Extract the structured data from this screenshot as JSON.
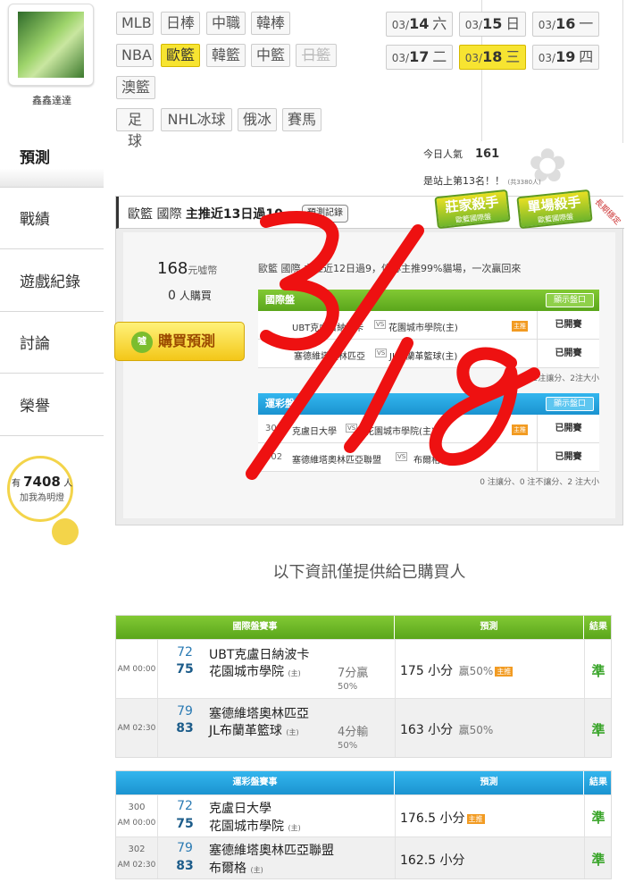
{
  "user": {
    "name": "鑫鑫達達"
  },
  "sidebar": {
    "items": [
      {
        "label": "預測",
        "active": true
      },
      {
        "label": "戰績"
      },
      {
        "label": "遊戲紀錄"
      },
      {
        "label": "討論"
      },
      {
        "label": "榮譽"
      }
    ]
  },
  "followers": {
    "prefix": "有",
    "count": "7408",
    "suffix": "人",
    "line2": "加我為明燈"
  },
  "sports": {
    "row1": [
      "MLB",
      "日棒",
      "中職",
      "韓棒"
    ],
    "row2": [
      "NBA",
      "歐籃",
      "韓籃",
      "中籃",
      "日籃"
    ],
    "row3": [
      "澳籃"
    ],
    "row4": [
      "足球",
      "NHL冰球",
      "俄冰",
      "賽馬"
    ],
    "selected": "歐籃",
    "disabled": "日籃"
  },
  "dates": [
    {
      "md": "03/",
      "d": "14",
      "wd": "六"
    },
    {
      "md": "03/",
      "d": "15",
      "wd": "日"
    },
    {
      "md": "03/",
      "d": "16",
      "wd": "一"
    },
    {
      "md": "03/",
      "d": "17",
      "wd": "二"
    },
    {
      "md": "03/",
      "d": "18",
      "wd": "三",
      "selected": true
    },
    {
      "md": "03/",
      "d": "19",
      "wd": "四"
    }
  ],
  "stats": {
    "pop_label": "今日人氣",
    "pop_value": "161",
    "rank_text": "是站上第13名！！",
    "rank_small": "(共3380人)"
  },
  "panel": {
    "league": "歐籃 國際",
    "headline": "主推近13日過10",
    "record_btn": "預測記錄",
    "badge1_title": "莊家殺手",
    "badge1_sub": "歐籃國際盤",
    "badge2_title": "單場殺手",
    "badge2_sub": "歐籃國際盤",
    "ribbon": "長期穩定",
    "price": "168",
    "price_unit": "元噓幣",
    "buyers": "0",
    "buyers_unit": "人購買",
    "buy_label": "購買預測",
    "buy_icon": "噓",
    "desc": "歐籃 國際 主推近12日過9，信心主推99%貓場，一次贏回來",
    "intl": {
      "title": "國際盤",
      "show": "顯示盤口",
      "rows": [
        {
          "num": "",
          "t1": "UBT克盧日納波卡",
          "t2": "花園城市學院(主)",
          "tag": "主推",
          "status": "已開賽"
        },
        {
          "num": "",
          "t1": "塞德維塔奧林匹亞",
          "t2": "JL布蘭革籃球(主)",
          "tag": "",
          "status": "已開賽"
        }
      ],
      "summary": "2注讓分、2注大小"
    },
    "lottery": {
      "title": "運彩盤",
      "show": "顯示盤口",
      "rows": [
        {
          "num": "300",
          "t1": "克盧日大學",
          "t2": "花園城市學院(主)",
          "tag": "主推",
          "status": "已開賽"
        },
        {
          "num": "302",
          "t1": "塞德維塔奧林匹亞聯盟",
          "t2": "布爾格(主)",
          "tag": "",
          "status": "已開賽"
        }
      ],
      "summary": "0 注讓分、0 注不讓分、2 注大小"
    }
  },
  "notice": "以下資訊僅提供給已購買人",
  "intl_table": {
    "headers": [
      "國際盤賽事",
      "預測",
      "結果"
    ],
    "rows": [
      {
        "time": "AM 00:00",
        "s1": "72",
        "s2": "75",
        "t1": "UBT克盧日納波卡",
        "t2": "花園城市學院",
        "home": "(主)",
        "hc1": "7分贏",
        "hc2": "50%",
        "pred": "175 小分",
        "pct": "贏50%",
        "tag": "主推",
        "res": "準"
      },
      {
        "time": "AM 02:30",
        "s1": "79",
        "s2": "83",
        "t1": "塞德維塔奧林匹亞",
        "t2": "JL布蘭革籃球",
        "home": "(主)",
        "hc1": "4分輸",
        "hc2": "50%",
        "pred": "163 小分",
        "pct": "贏50%",
        "tag": "",
        "res": "準"
      }
    ]
  },
  "lottery_table": {
    "headers": [
      "運彩盤賽事",
      "預測",
      "結果"
    ],
    "rows": [
      {
        "num": "300",
        "time": "AM 00:00",
        "s1": "72",
        "s2": "75",
        "t1": "克盧日大學",
        "t2": "花園城市學院",
        "home": "(主)",
        "pred": "176.5 小分",
        "tag": "主推",
        "res": "準"
      },
      {
        "num": "302",
        "time": "AM 02:30",
        "s1": "79",
        "s2": "83",
        "t1": "塞德維塔奧林匹亞聯盟",
        "t2": "布爾格",
        "home": "(主)",
        "pred": "162.5 小分",
        "tag": "",
        "res": "準"
      }
    ]
  },
  "colors": {
    "green": "#6bb826",
    "blue": "#22a3df",
    "yellow": "#f7e431",
    "annotation_red": "#ee1111"
  }
}
